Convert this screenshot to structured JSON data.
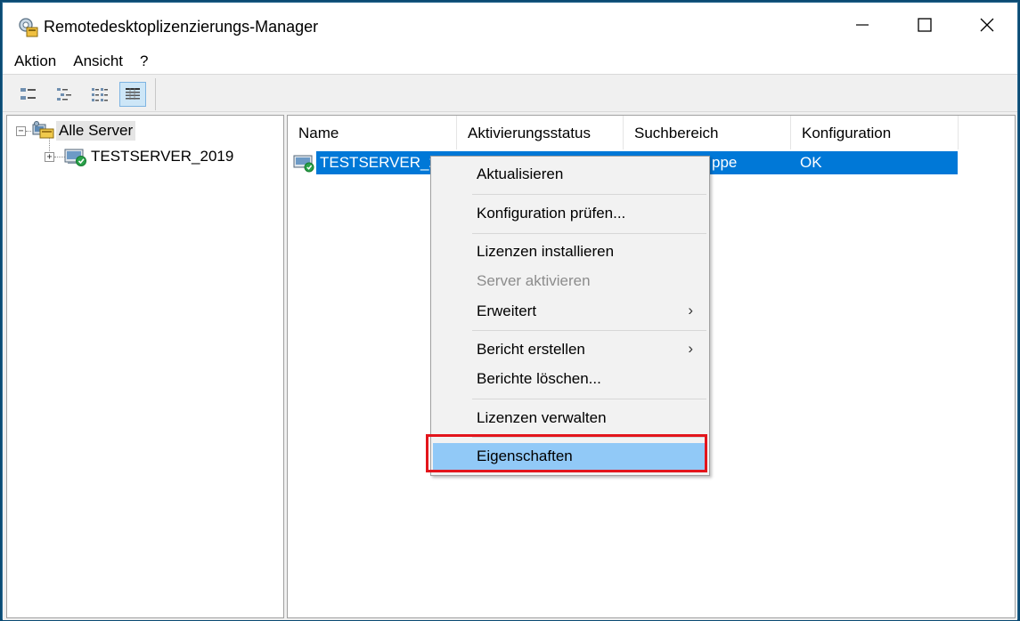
{
  "window": {
    "title": "Remotedesktoplizenzierungs-Manager"
  },
  "menu": [
    "Aktion",
    "Ansicht",
    "?"
  ],
  "tree": {
    "root_label": "Alle Server",
    "child_label": "TESTSERVER_2019"
  },
  "list": {
    "columns": [
      "Name",
      "Aktivierungsstatus",
      "Suchbereich",
      "Konfiguration"
    ],
    "row": {
      "name": "TESTSERVER_20",
      "suchbereich": "ppe",
      "konfiguration": "OK"
    }
  },
  "context_menu": {
    "items": [
      {
        "label": "Aktualisieren"
      },
      {
        "label": "Konfiguration prüfen..."
      },
      {
        "label": "Lizenzen installieren"
      },
      {
        "label": "Server aktivieren",
        "disabled": true
      },
      {
        "label": "Erweitert",
        "submenu": true
      },
      {
        "label": "Bericht erstellen",
        "submenu": true
      },
      {
        "label": "Berichte löschen..."
      },
      {
        "label": "Lizenzen verwalten"
      },
      {
        "label": "Eigenschaften",
        "highlighted": true
      }
    ],
    "submenu_arrow": "›"
  },
  "colors": {
    "selection": "#0078d7",
    "menu_highlight": "#91c9f7",
    "annotation_box": "#e3151c"
  },
  "icons": [
    "app-license-icon",
    "minimize-icon",
    "maximize-icon",
    "close-icon",
    "console-tree-icon",
    "small-icons-icon",
    "list-icon",
    "details-icon",
    "server-group-icon",
    "server-ok-icon"
  ]
}
